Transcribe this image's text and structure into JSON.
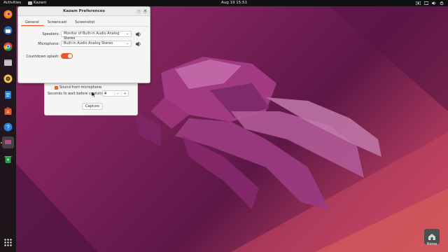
{
  "topbar": {
    "activities": "Activities",
    "app_name": "Kazam",
    "clock": "Aug 19  15:51"
  },
  "dock": {
    "items": [
      "firefox-icon",
      "thunderbird-icon",
      "chrome-icon",
      "files-icon",
      "rhythmbox-icon",
      "writer-icon",
      "software-icon",
      "help-icon",
      "kazam-icon",
      "trash-icon"
    ],
    "apps_grid": "apps-grid-icon"
  },
  "desktop": {
    "home_label": "Home"
  },
  "capture_window": {
    "sound_mic": "Sound from microphone",
    "wait_label": "Seconds to wait before capturing:",
    "wait_value": "4",
    "minus": "−",
    "plus": "+",
    "capture_button": "Capture"
  },
  "preferences": {
    "title": "Kazam Preferences",
    "tabs": [
      "General",
      "Screencast",
      "Screenshot"
    ],
    "speakers_label": "Speakers:",
    "speakers_value": "Monitor of Built-in Audio Analog Stereo",
    "microphone_label": "Microphone:",
    "microphone_value": "Built-in Audio Analog Stereo",
    "countdown_label": "Countdown splash:",
    "countdown_on": true
  },
  "colors": {
    "accent": "#e95420",
    "panel": "#111111"
  }
}
